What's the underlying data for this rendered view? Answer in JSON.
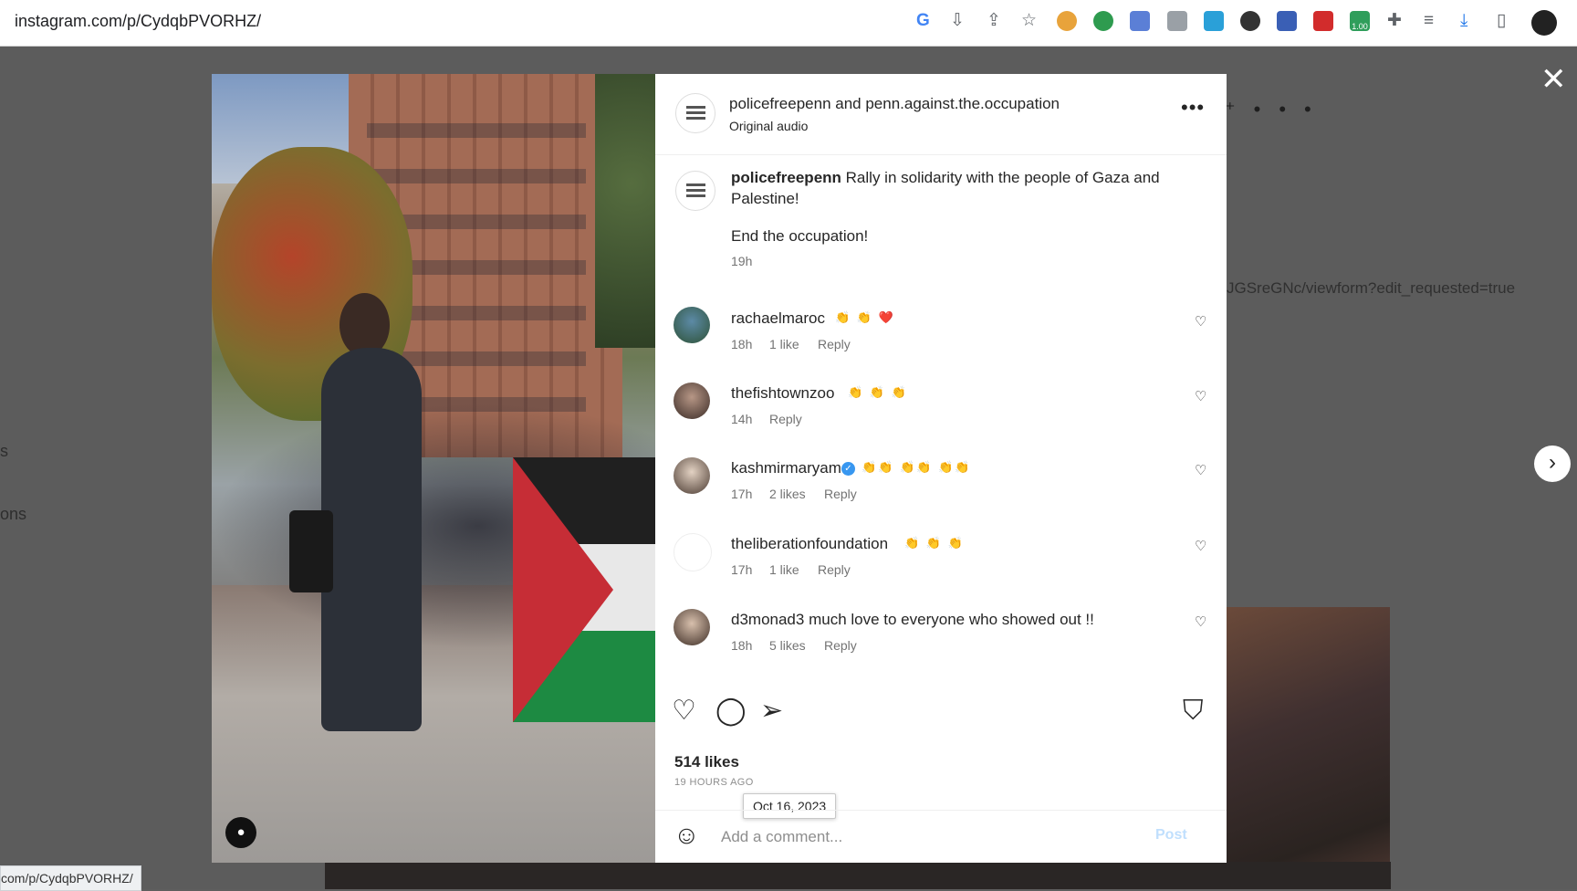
{
  "browser": {
    "url": "instagram.com/p/CydqbPVORHZ/",
    "status_url": "com/p/CydqbPVORHZ/",
    "ext_badge": "1.00"
  },
  "background": {
    "url_fragment": "JGSreGNc/viewform?edit_requested=true",
    "side_text_1": "s",
    "side_text_2": "ons"
  },
  "post": {
    "header_users": "policefreepenn and penn.against.the.occupation",
    "audio": "Original audio",
    "caption": {
      "username": "policefreepenn",
      "text_1": "Rally in solidarity with the people of Gaza and Palestine!",
      "text_2": "End the occupation!",
      "time": "19h"
    },
    "comments": [
      {
        "username": "rachaelmaroc",
        "text": "👏 👏 ❤️",
        "time": "18h",
        "likes": "1 like",
        "reply": "Reply",
        "verified": false
      },
      {
        "username": "thefishtownzoo",
        "text": "👏 👏 👏",
        "time": "14h",
        "likes": "",
        "reply": "Reply",
        "verified": false
      },
      {
        "username": "kashmirmaryam",
        "text": "👏👏 👏👏 👏👏",
        "time": "17h",
        "likes": "2 likes",
        "reply": "Reply",
        "verified": true
      },
      {
        "username": "theliberationfoundation",
        "text": "👏 👏 👏",
        "time": "17h",
        "likes": "1 like",
        "reply": "Reply",
        "verified": false
      },
      {
        "username": "d3monad3",
        "text": "much love to everyone who showed out !!",
        "time": "18h",
        "likes": "5 likes",
        "reply": "Reply",
        "verified": false
      }
    ],
    "likes": "514 likes",
    "posted_ago": "19 HOURS AGO",
    "date_tooltip": "Oct 16, 2023",
    "comment_placeholder": "Add a comment...",
    "post_button": "Post"
  },
  "icons": {
    "more": "more-icon",
    "heart": "heart-icon",
    "comment": "comment-icon",
    "share": "share-icon",
    "save": "bookmark-icon",
    "emoji": "emoji-icon",
    "close": "close-icon",
    "next": "chevron-right-icon",
    "sound": "speaker-icon",
    "tags": "user-tag-icon"
  }
}
